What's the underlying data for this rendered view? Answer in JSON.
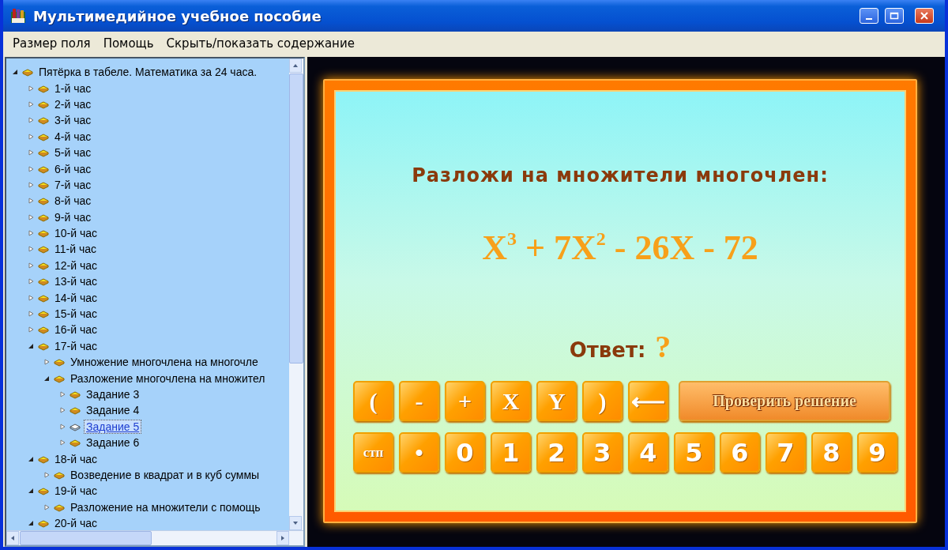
{
  "window": {
    "title": "Мультимедийное учебное пособие"
  },
  "menu": [
    {
      "label": "Размер поля"
    },
    {
      "label": "Помощь"
    },
    {
      "label": "Скрыть/показать содержание"
    }
  ],
  "tree": [
    {
      "label": "Пятёрка в табеле. Математика за 24 часа.",
      "expanded": true,
      "selected": false,
      "children": [
        {
          "label": "1-й час",
          "expanded": false,
          "selected": false
        },
        {
          "label": "2-й час",
          "expanded": false,
          "selected": false
        },
        {
          "label": "3-й час",
          "expanded": false,
          "selected": false
        },
        {
          "label": "4-й час",
          "expanded": false,
          "selected": false
        },
        {
          "label": "5-й час",
          "expanded": false,
          "selected": false
        },
        {
          "label": "6-й час",
          "expanded": false,
          "selected": false
        },
        {
          "label": "7-й час",
          "expanded": false,
          "selected": false
        },
        {
          "label": "8-й час",
          "expanded": false,
          "selected": false
        },
        {
          "label": "9-й час",
          "expanded": false,
          "selected": false
        },
        {
          "label": "10-й час",
          "expanded": false,
          "selected": false
        },
        {
          "label": "11-й час",
          "expanded": false,
          "selected": false
        },
        {
          "label": "12-й час",
          "expanded": false,
          "selected": false
        },
        {
          "label": "13-й час",
          "expanded": false,
          "selected": false
        },
        {
          "label": "14-й час",
          "expanded": false,
          "selected": false
        },
        {
          "label": "15-й час",
          "expanded": false,
          "selected": false
        },
        {
          "label": "16-й час",
          "expanded": false,
          "selected": false
        },
        {
          "label": "17-й час",
          "expanded": true,
          "selected": false,
          "children": [
            {
              "label": "Умножение многочлена на многочле",
              "expanded": false,
              "selected": false
            },
            {
              "label": "Разложение многочлена на множител",
              "expanded": true,
              "selected": false,
              "children": [
                {
                  "label": "Задание 3",
                  "expanded": false,
                  "selected": false
                },
                {
                  "label": "Задание 4",
                  "expanded": false,
                  "selected": false
                },
                {
                  "label": "Задание 5",
                  "expanded": false,
                  "selected": true
                },
                {
                  "label": "Задание 6",
                  "expanded": false,
                  "selected": false
                }
              ]
            }
          ]
        },
        {
          "label": "18-й час",
          "expanded": true,
          "selected": false,
          "children": [
            {
              "label": "Возведение в квадрат и в куб суммы",
              "expanded": false,
              "selected": false
            }
          ]
        },
        {
          "label": "19-й час",
          "expanded": true,
          "selected": false,
          "children": [
            {
              "label": "Разложение на множители с помощь",
              "expanded": false,
              "selected": false
            }
          ]
        },
        {
          "label": "20-й час",
          "expanded": true,
          "selected": false
        }
      ]
    }
  ],
  "task": {
    "prompt": "Разложи на множители многочлен:",
    "formula": "X$^{3}$ + 7X$^{2}$ - 26X - 72",
    "answer_label": "Ответ:",
    "answer": "?"
  },
  "keypad": {
    "row_1": [
      "(",
      "-",
      "+",
      "X",
      "Y",
      ")",
      "⟵"
    ],
    "check_button": "Проверить решение",
    "row_2": [
      "стп",
      "•",
      "0",
      "1",
      "2",
      "3",
      "4",
      "5",
      "6",
      "7",
      "8",
      "9"
    ]
  }
}
